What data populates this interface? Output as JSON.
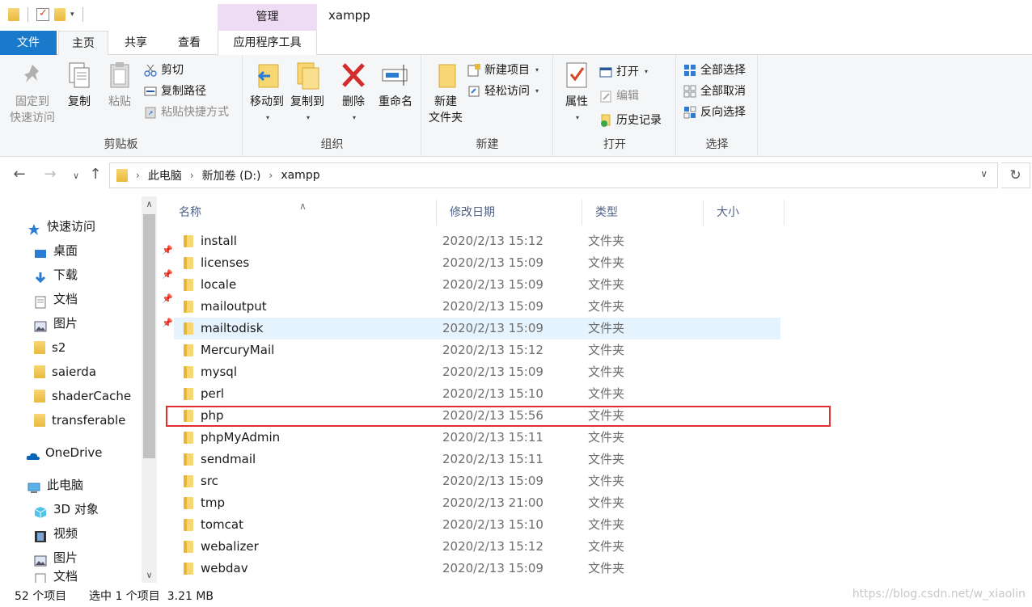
{
  "title": {
    "manage_tab": "管理",
    "window_title": "xampp"
  },
  "ribbon_tabs": {
    "file": "文件",
    "home": "主页",
    "share": "共享",
    "view": "查看",
    "app_tools": "应用程序工具"
  },
  "clipboard": {
    "pin_line1": "固定到",
    "pin_line2": "快速访问",
    "copy": "复制",
    "paste": "粘贴",
    "cut": "剪切",
    "copy_path": "复制路径",
    "paste_shortcut": "粘贴快捷方式",
    "label": "剪贴板"
  },
  "organize": {
    "move_to": "移动到",
    "copy_to": "复制到",
    "delete": "删除",
    "rename": "重命名",
    "label": "组织"
  },
  "new_group": {
    "new_folder_line1": "新建",
    "new_folder_line2": "文件夹",
    "new_item": "新建项目",
    "easy_access": "轻松访问",
    "label": "新建"
  },
  "open_group": {
    "properties": "属性",
    "open": "打开",
    "edit": "编辑",
    "history": "历史记录",
    "label": "打开"
  },
  "select_group": {
    "select_all": "全部选择",
    "select_none": "全部取消",
    "invert": "反向选择",
    "label": "选择"
  },
  "address": {
    "crumbs": [
      "此电脑",
      "新加卷 (D:)",
      "xampp"
    ]
  },
  "nav_pane": {
    "quick_access": "快速访问",
    "items": [
      "桌面",
      "下载",
      "文档",
      "图片",
      "s2",
      "saierda",
      "shaderCache",
      "transferable"
    ],
    "onedrive": "OneDrive",
    "this_pc": "此电脑",
    "pc_items": [
      "3D 对象",
      "视频",
      "图片",
      "文档"
    ]
  },
  "columns": {
    "name": "名称",
    "modified": "修改日期",
    "type": "类型",
    "size": "大小"
  },
  "files": [
    {
      "name": "install",
      "date": "2020/2/13 15:12",
      "type": "文件夹"
    },
    {
      "name": "licenses",
      "date": "2020/2/13 15:09",
      "type": "文件夹"
    },
    {
      "name": "locale",
      "date": "2020/2/13 15:09",
      "type": "文件夹"
    },
    {
      "name": "mailoutput",
      "date": "2020/2/13 15:09",
      "type": "文件夹"
    },
    {
      "name": "mailtodisk",
      "date": "2020/2/13 15:09",
      "type": "文件夹"
    },
    {
      "name": "MercuryMail",
      "date": "2020/2/13 15:12",
      "type": "文件夹"
    },
    {
      "name": "mysql",
      "date": "2020/2/13 15:09",
      "type": "文件夹"
    },
    {
      "name": "perl",
      "date": "2020/2/13 15:10",
      "type": "文件夹"
    },
    {
      "name": "php",
      "date": "2020/2/13 15:56",
      "type": "文件夹"
    },
    {
      "name": "phpMyAdmin",
      "date": "2020/2/13 15:11",
      "type": "文件夹"
    },
    {
      "name": "sendmail",
      "date": "2020/2/13 15:11",
      "type": "文件夹"
    },
    {
      "name": "src",
      "date": "2020/2/13 15:09",
      "type": "文件夹"
    },
    {
      "name": "tmp",
      "date": "2020/2/13 21:00",
      "type": "文件夹"
    },
    {
      "name": "tomcat",
      "date": "2020/2/13 15:10",
      "type": "文件夹"
    },
    {
      "name": "webalizer",
      "date": "2020/2/13 15:12",
      "type": "文件夹"
    },
    {
      "name": "webdav",
      "date": "2020/2/13 15:09",
      "type": "文件夹"
    }
  ],
  "status": {
    "count": "52 个项目",
    "selection": "选中 1 个项目  3.21 MB",
    "watermark": "https://blog.csdn.net/w_xiaolin"
  },
  "colors": {
    "file_tab": "#1979ca",
    "manage_tab": "#eedcf4",
    "hover_row": "#e5f3ff",
    "highlight_box": "#e02e2e"
  }
}
